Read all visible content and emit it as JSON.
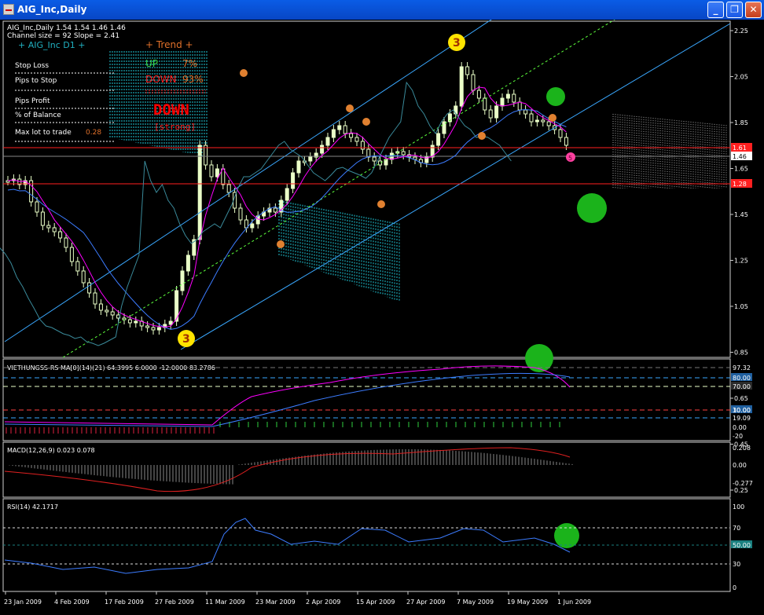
{
  "window": {
    "title": "AIG_Inc,Daily",
    "minimize_glyph": "_",
    "restore_glyph": "❐",
    "close_glyph": "✕"
  },
  "header": {
    "line1": "AIG_Inc,Daily  1.54 1.54 1.46 1.46",
    "line2": "Channel size = 92 Slope = 2.41"
  },
  "panel": {
    "symbol": "+  AIG_Inc D1  +",
    "trend_title": "+  Trend  +",
    "up_label": "UP",
    "up_value": "7%",
    "down_label": "DOWN",
    "down_value": "93%",
    "signal": "DOWN",
    "signal_sub": "[strong]",
    "stop_loss": "Stop Loss",
    "pips_to_stop": "Pips to Stop",
    "pips_profit": "Pips Profit",
    "pct_balance": "% of Balance",
    "max_lot": "Max lot to trade",
    "max_lot_value": "0.28"
  },
  "markers": {
    "wave3": "3",
    "wave3_low": "3",
    "circle_5": "5"
  },
  "price_axis": {
    "ticks": [
      "2.25",
      "2.05",
      "1.85",
      "1.65",
      "1.45",
      "1.25",
      "1.05",
      "0.85",
      "0.65",
      "0.45",
      "0.25"
    ],
    "tag_upper": "1.61",
    "tag_current": "1.46",
    "tag_lower": "1.28"
  },
  "indicator1": {
    "label": "VIETHUNGSS-RS MA[0](14)(21) 64.3995 6.0000 -12.0000 83.2786",
    "ticks": [
      "97.32",
      "80.00",
      "70.00",
      "30.00",
      "19.09",
      "10.00",
      "0.00",
      "-20"
    ]
  },
  "macd": {
    "label": "MACD(12,26,9) 0.023 0.078",
    "ticks": [
      "0.208",
      "0.00",
      "-0.277"
    ]
  },
  "rsi": {
    "label": "RSI(14) 42.1717",
    "ticks": [
      "100",
      "70",
      "50.00",
      "30",
      "0"
    ]
  },
  "time_axis": [
    "23 Jan 2009",
    "4 Feb 2009",
    "17 Feb 2009",
    "27 Feb 2009",
    "11 Mar 2009",
    "23 Mar 2009",
    "2 Apr 2009",
    "15 Apr 2009",
    "27 Apr 2009",
    "7 May 2009",
    "19 May 2009",
    "1 Jun 2009"
  ],
  "colors": {
    "bull": "#eaffc8",
    "bear": "#eaffc8",
    "ma_fast": "#ff00ff",
    "ma_slow": "#3c7cff",
    "channel": "#3aa8ff",
    "midline": "#5cff3c",
    "level": "#ff2020"
  }
}
